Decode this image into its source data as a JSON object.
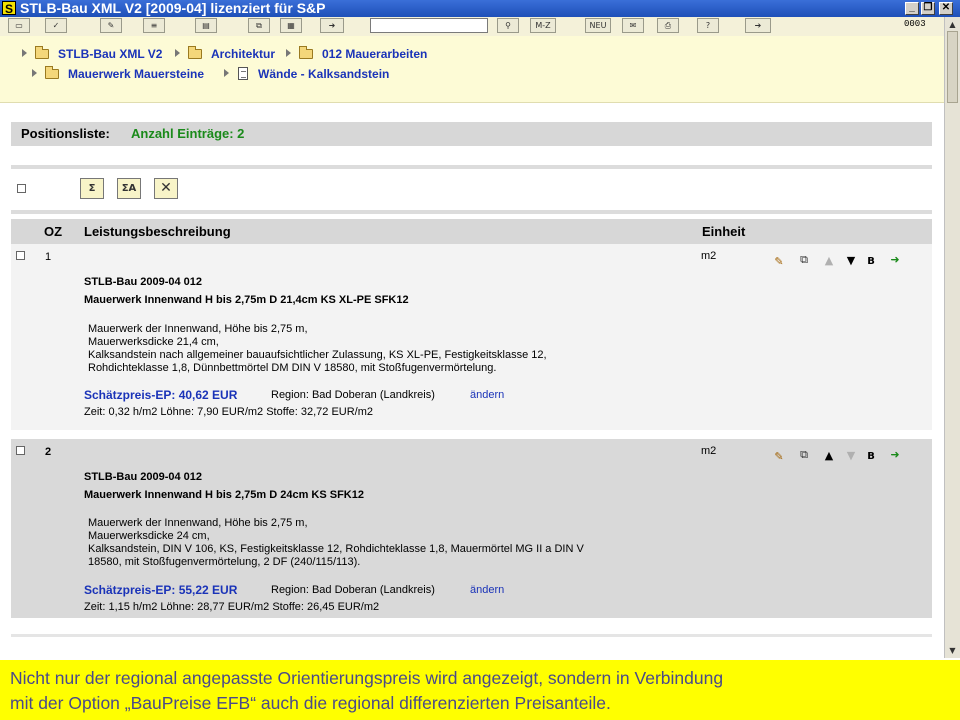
{
  "window": {
    "logo": "S",
    "title": "STLB-Bau XML V2 [2009-04] lizenziert für S&P",
    "buttons": {
      "minimize": "_",
      "restore": "❐",
      "close": "✕"
    }
  },
  "toolbar": {
    "btn_mz": "M-Z",
    "btn_neu": "NEU",
    "code": "0003"
  },
  "breadcrumb": {
    "items": [
      "STLB-Bau XML V2",
      "Architektur",
      "012 Mauerarbeiten",
      "Mauerwerk Mauersteine",
      "Wände - Kalksandstein"
    ]
  },
  "positionsliste": {
    "label": "Positionsliste:",
    "count": "Anzahl Einträge: 2"
  },
  "columns": {
    "oz": "OZ",
    "beschreibung": "Leistungsbeschreibung",
    "einheit": "Einheit"
  },
  "rows": [
    {
      "oz": "1",
      "unit": "m2",
      "code": "STLB-Bau 2009-04 012",
      "title": "Mauerwerk Innenwand H bis 2,75m D 21,4cm KS XL-PE SFK12",
      "description": "Mauerwerk der Innenwand, Höhe bis 2,75 m,\nMauerwerksdicke 21,4 cm,\nKalksandstein nach allgemeiner bauaufsichtlicher Zulassung, KS XL-PE, Festigkeitsklasse 12,\nRohdichteklasse 1,8, Dünnbettmörtel DM DIN V 18580, mit Stoßfugenvermörtelung.",
      "price": "Schätzpreis-EP: 40,62 EUR",
      "region": "Region: Bad Doberan (Landkreis)",
      "change": "ändern",
      "zeit": "Zeit: 0,32 h/m2  Löhne: 7,90 EUR/m2  Stoffe: 32,72 EUR/m2"
    },
    {
      "oz": "2",
      "unit": "m2",
      "code": "STLB-Bau 2009-04 012",
      "title": "Mauerwerk Innenwand H bis 2,75m D 24cm KS SFK12",
      "description": "Mauerwerk der Innenwand, Höhe bis 2,75 m,\nMauerwerksdicke 24 cm,\nKalksandstein, DIN V 106, KS, Festigkeitsklasse 12, Rohdichteklasse 1,8, Mauermörtel MG II a DIN V\n18580, mit Stoßfugenvermörtelung, 2 DF (240/115/113).",
      "price": "Schätzpreis-EP: 55,22 EUR",
      "region": "Region: Bad Doberan (Landkreis)",
      "change": "ändern",
      "zeit": "Zeit: 1,15 h/m2  Löhne: 28,77 EUR/m2  Stoffe: 26,45 EUR/m2"
    }
  ],
  "row_action_b": "B",
  "caption": {
    "line1": "Nicht nur der regional angepasste Orientierungspreis wird angezeigt, sondern in Verbindung",
    "line2": "mit der Option „BauPreise EFB“  auch die regional differenzierten Preisanteile."
  },
  "colors": {
    "title_bar": "#1e4fb8",
    "link_blue": "#1a33b8",
    "count_green": "#1a8a1a",
    "caption_bg": "#ffff00",
    "caption_text": "#4a4a8a"
  }
}
